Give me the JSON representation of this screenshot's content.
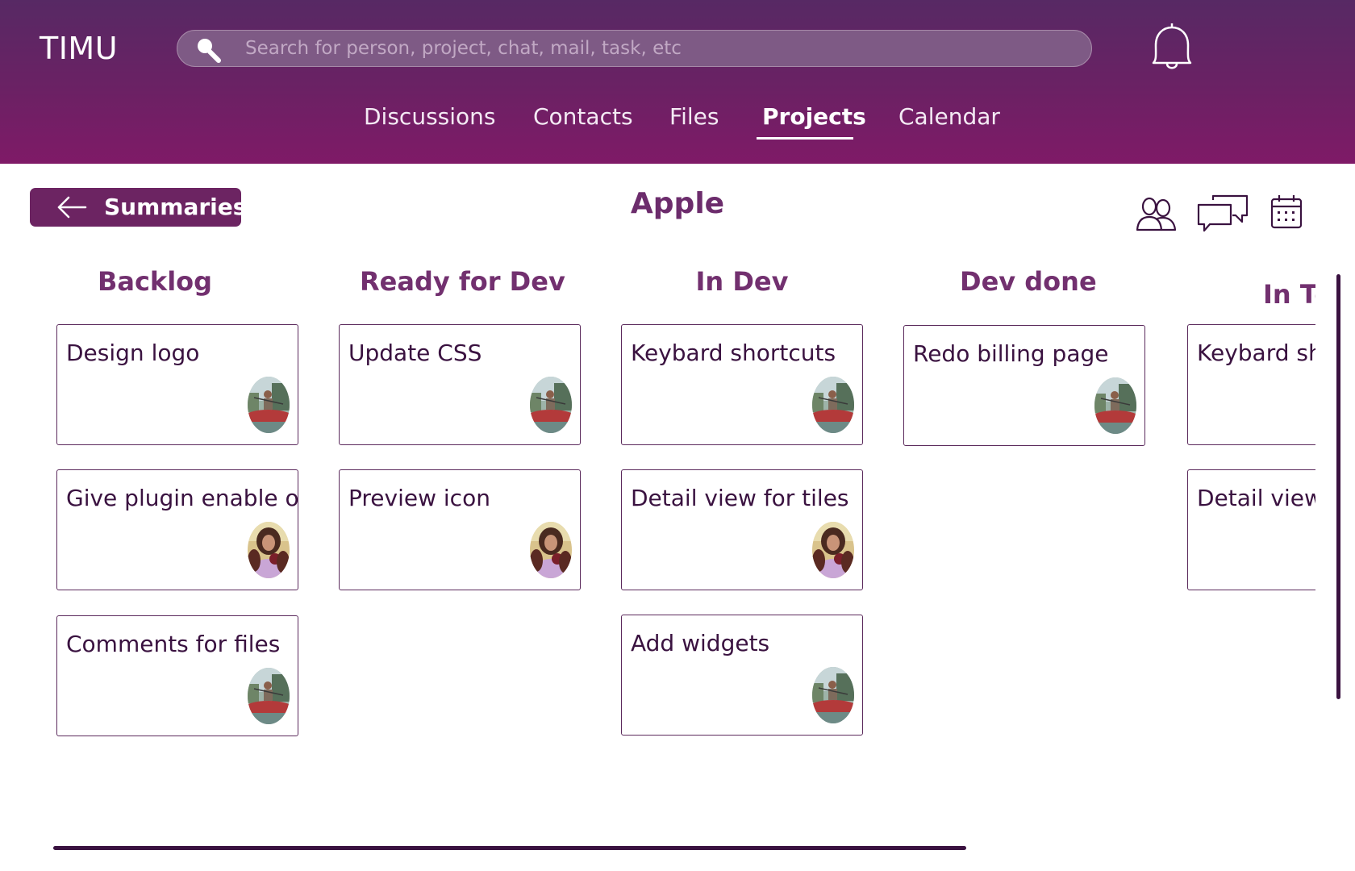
{
  "app": {
    "logo": "TIMU"
  },
  "search": {
    "placeholder": "Search for person, project, chat, mail, task, etc",
    "icon": "search-icon"
  },
  "notifications": {
    "icon": "bell-icon"
  },
  "nav": {
    "items": [
      {
        "label": "Discussions",
        "active": false
      },
      {
        "label": "Contacts",
        "active": false
      },
      {
        "label": "Files",
        "active": false
      },
      {
        "label": "Projects",
        "active": true
      },
      {
        "label": "Calendar",
        "active": false
      }
    ]
  },
  "toolbar": {
    "back_label": "Summaries",
    "back_icon": "arrow-left-icon",
    "project_title": "Apple",
    "actions": [
      "people-icon",
      "chat-bubbles-icon",
      "calendar-icon"
    ]
  },
  "board": {
    "columns": [
      {
        "title": "Backlog",
        "cards": [
          {
            "title": "Design logo",
            "avatar": "avatar-kayak"
          },
          {
            "title": "Give plugin enable opt",
            "avatar": "avatar-woman"
          },
          {
            "title": "Comments for files",
            "avatar": "avatar-kayak"
          }
        ]
      },
      {
        "title": "Ready for Dev",
        "cards": [
          {
            "title": "Update CSS",
            "avatar": "avatar-kayak"
          },
          {
            "title": "Preview icon",
            "avatar": "avatar-woman"
          }
        ]
      },
      {
        "title": "In Dev",
        "cards": [
          {
            "title": "Keybard shortcuts",
            "avatar": "avatar-kayak"
          },
          {
            "title": "Detail view for tiles",
            "avatar": "avatar-woman"
          },
          {
            "title": "Add widgets",
            "avatar": "avatar-kayak"
          }
        ]
      },
      {
        "title": "Dev done",
        "cards": [
          {
            "title": "Redo billing page",
            "avatar": "avatar-kayak"
          }
        ]
      },
      {
        "title": "In Te",
        "cards": [
          {
            "title": "Keybard sh",
            "avatar": "avatar-kayak"
          },
          {
            "title": "Detail view",
            "avatar": "avatar-woman"
          }
        ]
      }
    ]
  },
  "colors": {
    "header_top": "#572964",
    "header_bottom": "#7f1a67",
    "accent": "#6c2462",
    "text": "#3a1240"
  }
}
